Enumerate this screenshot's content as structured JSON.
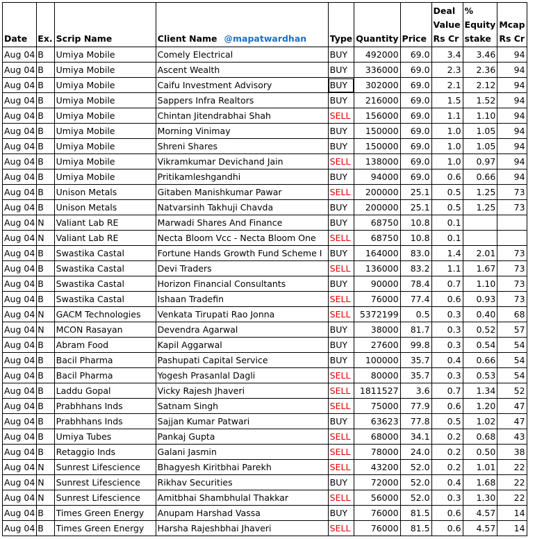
{
  "headers": {
    "date": "Date",
    "ex": "Ex.",
    "scrip": "Scrip Name",
    "client": "Client Name",
    "handle": "@mapatwardhan",
    "type": "Type",
    "quantity": "Quantity",
    "price": "Price",
    "deal_value": "Deal Value Rs Cr",
    "equity_stake": "% Equity stake",
    "mcap": "Mcap Rs Cr"
  },
  "colors": {
    "sell": "#e00000",
    "handle": "#1f6fc5"
  },
  "rows": [
    {
      "date": "Aug 04",
      "ex": "B",
      "scrip": "Umiya Mobile",
      "client": "Comely Electrical",
      "type": "BUY",
      "qty": "492000",
      "price": "69.0",
      "value": "3.4",
      "stake": "3.46",
      "mcap": "94"
    },
    {
      "date": "Aug 04",
      "ex": "B",
      "scrip": "Umiya Mobile",
      "client": "Ascent Wealth",
      "type": "BUY",
      "qty": "336000",
      "price": "69.0",
      "value": "2.3",
      "stake": "2.36",
      "mcap": "94"
    },
    {
      "date": "Aug 04",
      "ex": "B",
      "scrip": "Umiya Mobile",
      "client": "Caifu Investment Advisory",
      "type": "BUY",
      "qty": "302000",
      "price": "69.0",
      "value": "2.1",
      "stake": "2.12",
      "mcap": "94"
    },
    {
      "date": "Aug 04",
      "ex": "B",
      "scrip": "Umiya Mobile",
      "client": "Sappers Infra Realtors",
      "type": "BUY",
      "qty": "216000",
      "price": "69.0",
      "value": "1.5",
      "stake": "1.52",
      "mcap": "94"
    },
    {
      "date": "Aug 04",
      "ex": "B",
      "scrip": "Umiya Mobile",
      "client": "Chintan Jitendrabhai Shah",
      "type": "SELL",
      "qty": "156000",
      "price": "69.0",
      "value": "1.1",
      "stake": "1.10",
      "mcap": "94"
    },
    {
      "date": "Aug 04",
      "ex": "B",
      "scrip": "Umiya Mobile",
      "client": "Morning Vinimay",
      "type": "BUY",
      "qty": "150000",
      "price": "69.0",
      "value": "1.0",
      "stake": "1.05",
      "mcap": "94"
    },
    {
      "date": "Aug 04",
      "ex": "B",
      "scrip": "Umiya Mobile",
      "client": "Shreni Shares",
      "type": "BUY",
      "qty": "150000",
      "price": "69.0",
      "value": "1.0",
      "stake": "1.05",
      "mcap": "94"
    },
    {
      "date": "Aug 04",
      "ex": "B",
      "scrip": "Umiya Mobile",
      "client": "Vikramkumar Devichand Jain",
      "type": "SELL",
      "qty": "138000",
      "price": "69.0",
      "value": "1.0",
      "stake": "0.97",
      "mcap": "94"
    },
    {
      "date": "Aug 04",
      "ex": "B",
      "scrip": "Umiya Mobile",
      "client": "Pritikamleshgandhi",
      "type": "BUY",
      "qty": "94000",
      "price": "69.0",
      "value": "0.6",
      "stake": "0.66",
      "mcap": "94"
    },
    {
      "date": "Aug 04",
      "ex": "B",
      "scrip": "Unison Metals",
      "client": "Gitaben Manishkumar Pawar",
      "type": "SELL",
      "qty": "200000",
      "price": "25.1",
      "value": "0.5",
      "stake": "1.25",
      "mcap": "73"
    },
    {
      "date": "Aug 04",
      "ex": "B",
      "scrip": "Unison Metals",
      "client": "Natvarsinh Takhuji Chavda",
      "type": "BUY",
      "qty": "200000",
      "price": "25.1",
      "value": "0.5",
      "stake": "1.25",
      "mcap": "73"
    },
    {
      "date": "Aug 04",
      "ex": "N",
      "scrip": "Valiant Lab RE",
      "client": "Marwadi Shares And Finance",
      "type": "BUY",
      "qty": "68750",
      "price": "10.8",
      "value": "0.1",
      "stake": "",
      "mcap": ""
    },
    {
      "date": "Aug 04",
      "ex": "N",
      "scrip": "Valiant Lab RE",
      "client": "Necta Bloom Vcc - Necta Bloom One",
      "type": "SELL",
      "qty": "68750",
      "price": "10.8",
      "value": "0.1",
      "stake": "",
      "mcap": ""
    },
    {
      "date": "Aug 04",
      "ex": "B",
      "scrip": "Swastika Castal",
      "client": "Fortune Hands Growth Fund Scheme I",
      "type": "BUY",
      "qty": "164000",
      "price": "83.0",
      "value": "1.4",
      "stake": "2.01",
      "mcap": "73"
    },
    {
      "date": "Aug 04",
      "ex": "B",
      "scrip": "Swastika Castal",
      "client": "Devi Traders",
      "type": "SELL",
      "qty": "136000",
      "price": "83.2",
      "value": "1.1",
      "stake": "1.67",
      "mcap": "73"
    },
    {
      "date": "Aug 04",
      "ex": "B",
      "scrip": "Swastika Castal",
      "client": "Horizon Financial Consultants",
      "type": "BUY",
      "qty": "90000",
      "price": "78.4",
      "value": "0.7",
      "stake": "1.10",
      "mcap": "73"
    },
    {
      "date": "Aug 04",
      "ex": "B",
      "scrip": "Swastika Castal",
      "client": "Ishaan Tradefin",
      "type": "SELL",
      "qty": "76000",
      "price": "77.4",
      "value": "0.6",
      "stake": "0.93",
      "mcap": "73"
    },
    {
      "date": "Aug 04",
      "ex": "N",
      "scrip": "GACM Technologies",
      "client": "Venkata Tirupati Rao Jonna",
      "type": "SELL",
      "qty": "5372199",
      "price": "0.5",
      "value": "0.3",
      "stake": "0.40",
      "mcap": "68"
    },
    {
      "date": "Aug 04",
      "ex": "N",
      "scrip": "MCON Rasayan",
      "client": "Devendra Agarwal",
      "type": "BUY",
      "qty": "38000",
      "price": "81.7",
      "value": "0.3",
      "stake": "0.52",
      "mcap": "57"
    },
    {
      "date": "Aug 04",
      "ex": "B",
      "scrip": "Abram Food",
      "client": "Kapil Aggarwal",
      "type": "BUY",
      "qty": "27600",
      "price": "99.8",
      "value": "0.3",
      "stake": "0.54",
      "mcap": "54"
    },
    {
      "date": "Aug 04",
      "ex": "B",
      "scrip": "Bacil Pharma",
      "client": "Pashupati Capital Service",
      "type": "BUY",
      "qty": "100000",
      "price": "35.7",
      "value": "0.4",
      "stake": "0.66",
      "mcap": "54"
    },
    {
      "date": "Aug 04",
      "ex": "B",
      "scrip": "Bacil Pharma",
      "client": "Yogesh Prasanlal Dagli",
      "type": "SELL",
      "qty": "80000",
      "price": "35.7",
      "value": "0.3",
      "stake": "0.53",
      "mcap": "54"
    },
    {
      "date": "Aug 04",
      "ex": "B",
      "scrip": "Laddu Gopal",
      "client": "Vicky Rajesh Jhaveri",
      "type": "SELL",
      "qty": "1811527",
      "price": "3.6",
      "value": "0.7",
      "stake": "1.34",
      "mcap": "52"
    },
    {
      "date": "Aug 04",
      "ex": "B",
      "scrip": "Prabhhans Inds",
      "client": "Satnam Singh",
      "type": "SELL",
      "qty": "75000",
      "price": "77.9",
      "value": "0.6",
      "stake": "1.20",
      "mcap": "47"
    },
    {
      "date": "Aug 04",
      "ex": "B",
      "scrip": "Prabhhans Inds",
      "client": "Sajjan Kumar Patwari",
      "type": "BUY",
      "qty": "63623",
      "price": "77.8",
      "value": "0.5",
      "stake": "1.02",
      "mcap": "47"
    },
    {
      "date": "Aug 04",
      "ex": "B",
      "scrip": "Umiya Tubes",
      "client": "Pankaj Gupta",
      "type": "SELL",
      "qty": "68000",
      "price": "34.1",
      "value": "0.2",
      "stake": "0.68",
      "mcap": "43"
    },
    {
      "date": "Aug 04",
      "ex": "B",
      "scrip": "Retaggio Inds",
      "client": "Galani Jasmin",
      "type": "SELL",
      "qty": "78000",
      "price": "24.0",
      "value": "0.2",
      "stake": "0.50",
      "mcap": "38"
    },
    {
      "date": "Aug 04",
      "ex": "N",
      "scrip": "Sunrest Lifescience",
      "client": "Bhagyesh Kiritbhai Parekh",
      "type": "SELL",
      "qty": "43200",
      "price": "52.0",
      "value": "0.2",
      "stake": "1.01",
      "mcap": "22"
    },
    {
      "date": "Aug 04",
      "ex": "N",
      "scrip": "Sunrest Lifescience",
      "client": "Rikhav Securities",
      "type": "BUY",
      "qty": "72000",
      "price": "52.0",
      "value": "0.4",
      "stake": "1.68",
      "mcap": "22"
    },
    {
      "date": "Aug 04",
      "ex": "N",
      "scrip": "Sunrest Lifescience",
      "client": "Amitbhai Shambhulal Thakkar",
      "type": "SELL",
      "qty": "56000",
      "price": "52.0",
      "value": "0.3",
      "stake": "1.30",
      "mcap": "22"
    },
    {
      "date": "Aug 04",
      "ex": "B",
      "scrip": "Times Green Energy",
      "client": "Anupam Harshad Vassa",
      "type": "BUY",
      "qty": "76000",
      "price": "81.5",
      "value": "0.6",
      "stake": "4.57",
      "mcap": "14"
    },
    {
      "date": "Aug 04",
      "ex": "B",
      "scrip": "Times Green Energy",
      "client": "Harsha Rajeshbhai Jhaveri",
      "type": "SELL",
      "qty": "76000",
      "price": "81.5",
      "value": "0.6",
      "stake": "4.57",
      "mcap": "14"
    }
  ]
}
